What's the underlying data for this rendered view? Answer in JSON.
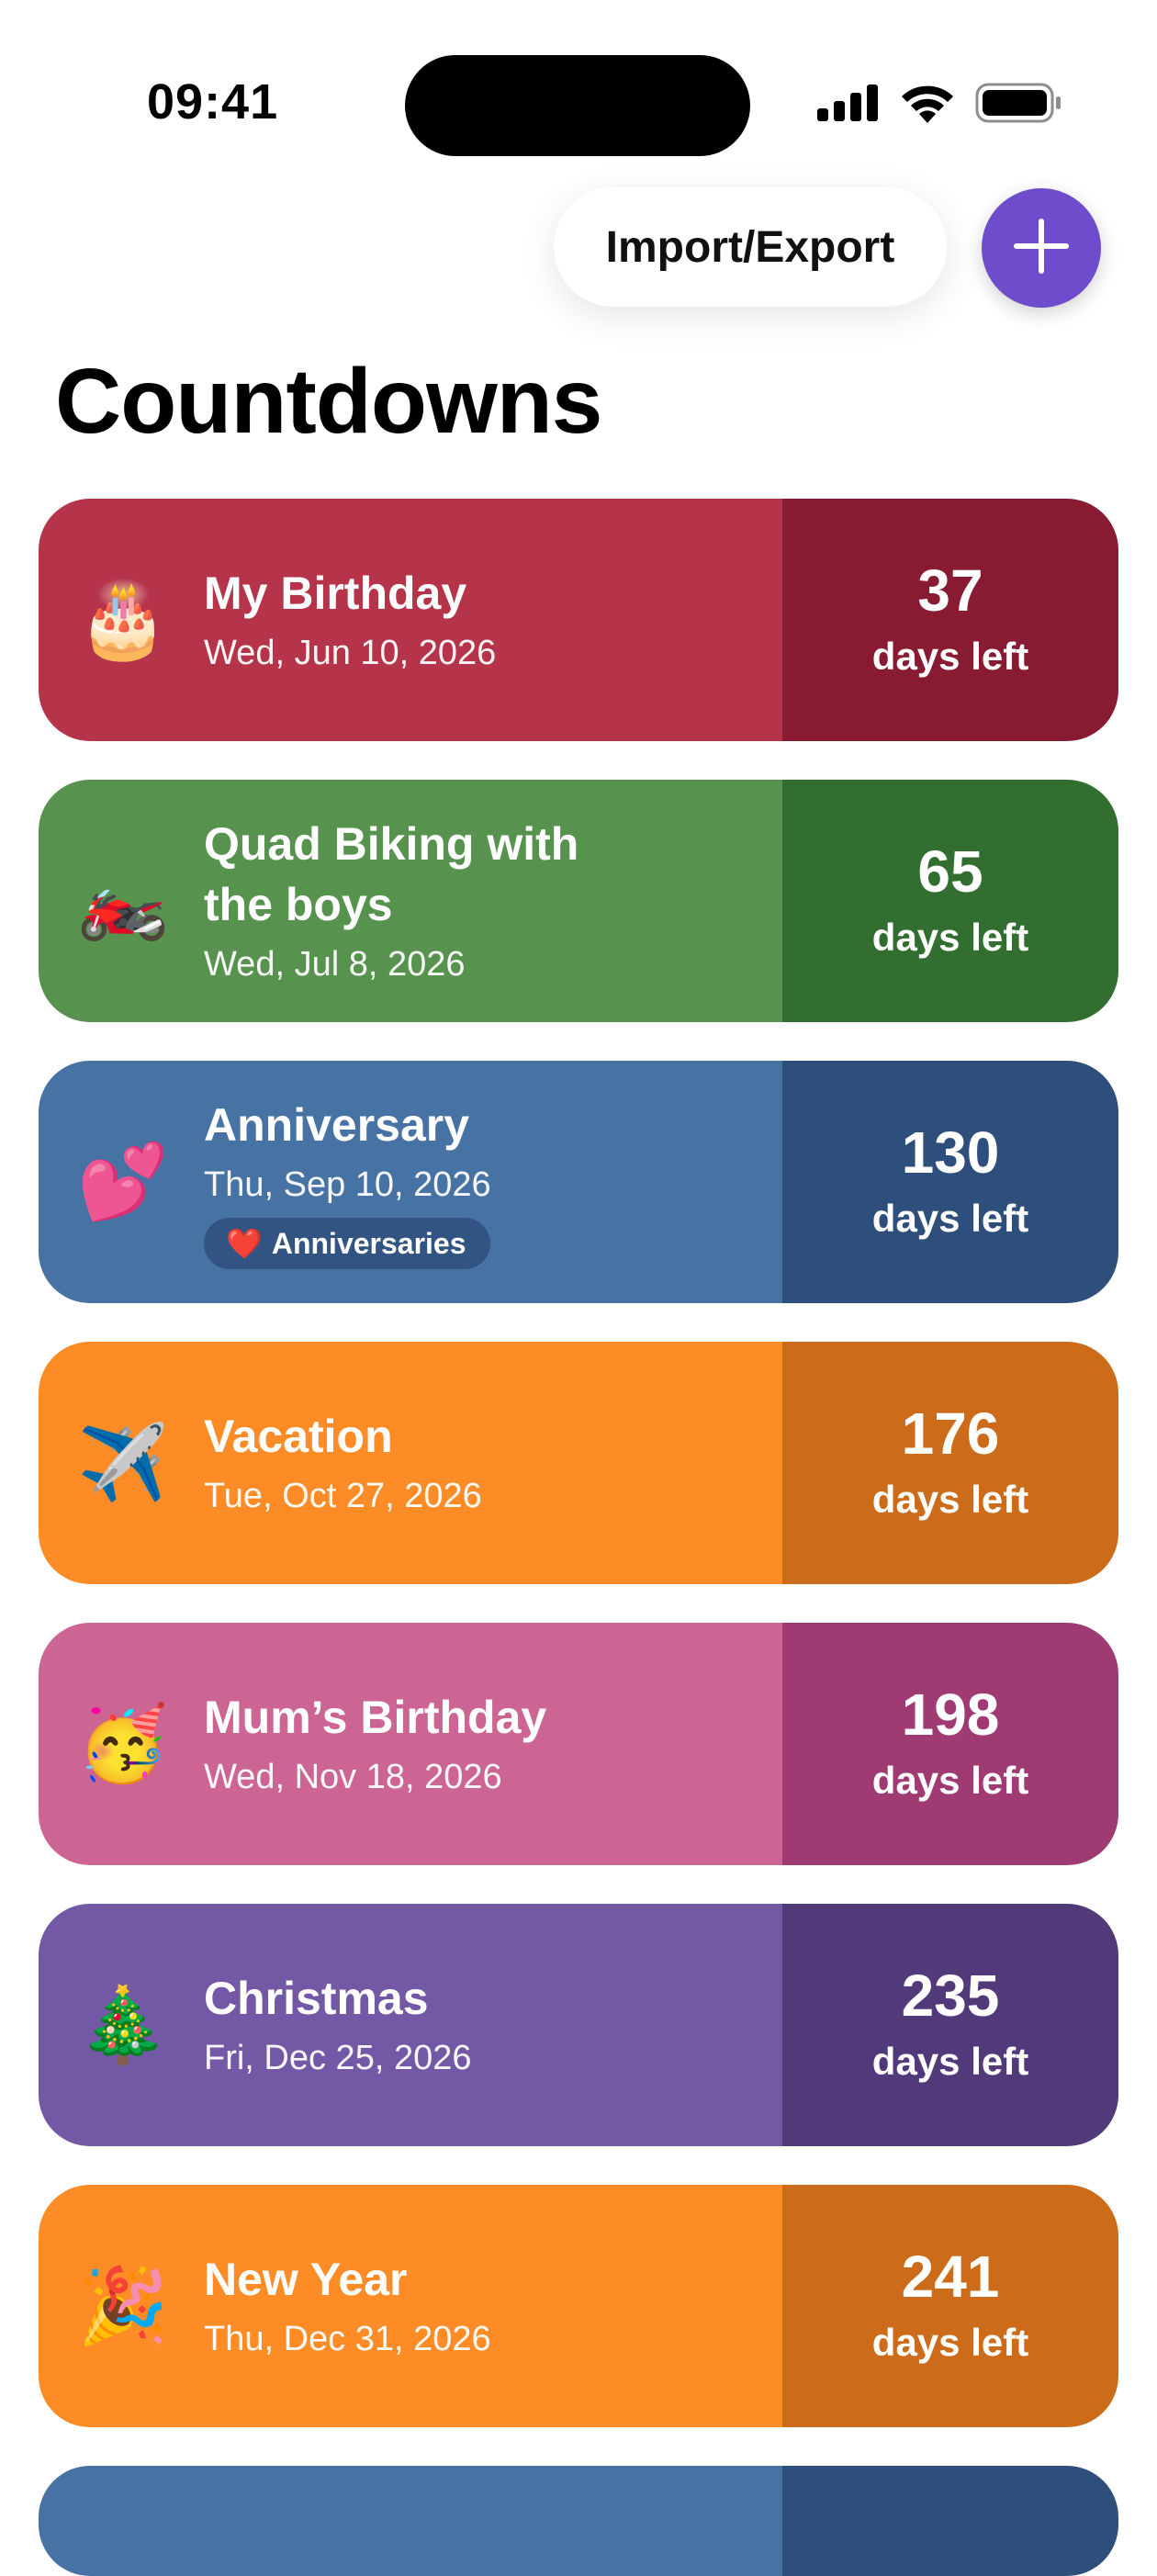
{
  "status_bar": {
    "time": "09:41",
    "icons": [
      "cellular-signal-icon",
      "wifi-icon",
      "battery-icon"
    ]
  },
  "header": {
    "import_export_label": "Import/Export",
    "add_icon": "plus-icon",
    "title": "Countdowns"
  },
  "colors": {
    "accent": "#6f4ccb"
  },
  "countdowns": [
    {
      "emoji": "🎂",
      "title": "My Birthday",
      "date": "Wed, Jun 10, 2026",
      "days": "37",
      "days_label": "days left",
      "color": "#b5344a",
      "side_color": "#881b32"
    },
    {
      "emoji": "🏍️",
      "title": "Quad Biking with the boys",
      "date": "Wed, Jul 8, 2026",
      "days": "65",
      "days_label": "days left",
      "color": "#57924f",
      "side_color": "#336e31"
    },
    {
      "emoji": "💕",
      "title": "Anniversary",
      "date": "Thu, Sep 10, 2026",
      "tag_emoji": "❤️",
      "tag": "Anniversaries",
      "days": "130",
      "days_label": "days left",
      "color": "#4672a4",
      "side_color": "#2e4f7b"
    },
    {
      "emoji": "✈️",
      "title": "Vacation",
      "date": "Tue, Oct 27, 2026",
      "days": "176",
      "days_label": "days left",
      "color": "#fd8c27",
      "side_color": "#cc6c1a"
    },
    {
      "emoji": "🥳",
      "title": "Mum’s Birthday",
      "date": "Wed, Nov 18, 2026",
      "days": "198",
      "days_label": "days left",
      "color": "#cd6594",
      "side_color": "#a03a72"
    },
    {
      "emoji": "🎄",
      "title": "Christmas",
      "date": "Fri, Dec 25, 2026",
      "days": "235",
      "days_label": "days left",
      "color": "#7358a6",
      "side_color": "#51397a"
    },
    {
      "emoji": "🎉",
      "title": "New Year",
      "date": "Thu, Dec 31, 2026",
      "days": "241",
      "days_label": "days left",
      "color": "#fd8c27",
      "side_color": "#cc6c1a"
    },
    {
      "color": "#4672a4",
      "side_color": "#2e4f7b"
    }
  ]
}
